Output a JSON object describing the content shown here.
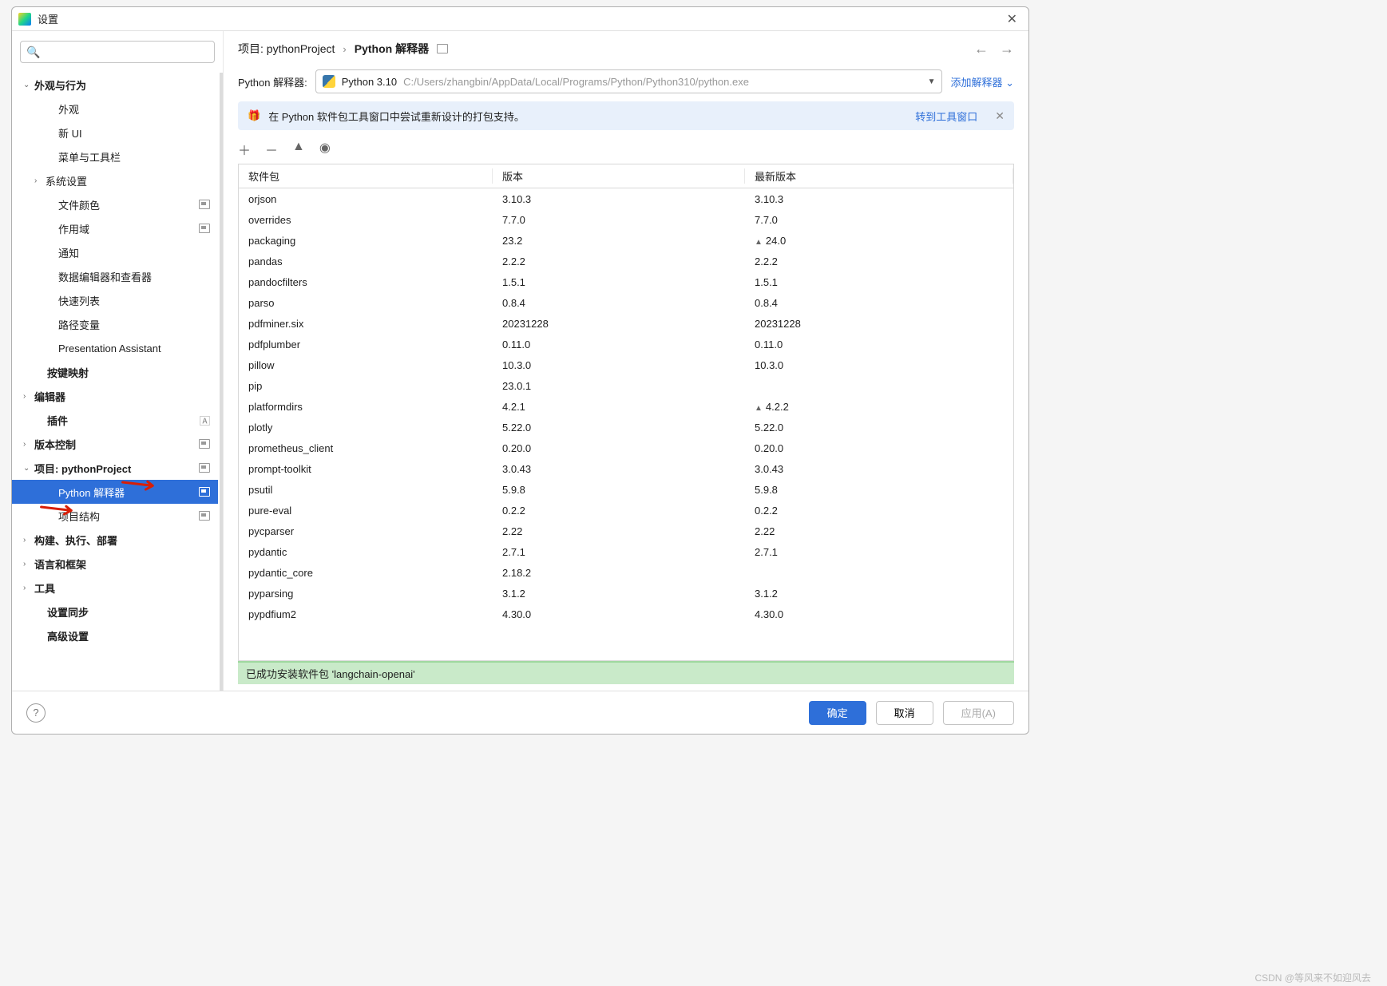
{
  "window": {
    "title": "设置"
  },
  "search": {
    "placeholder": ""
  },
  "sidebar": [
    {
      "label": "外观与行为",
      "bold": true,
      "chev": "v",
      "indent": 0
    },
    {
      "label": "外观",
      "indent": 2
    },
    {
      "label": "新 UI",
      "indent": 2
    },
    {
      "label": "菜单与工具栏",
      "indent": 2
    },
    {
      "label": "系统设置",
      "chev": ">",
      "indent": 1
    },
    {
      "label": "文件颜色",
      "indent": 2,
      "badge": true
    },
    {
      "label": "作用域",
      "indent": 2,
      "badge": true
    },
    {
      "label": "通知",
      "indent": 2
    },
    {
      "label": "数据编辑器和查看器",
      "indent": 2
    },
    {
      "label": "快速列表",
      "indent": 2
    },
    {
      "label": "路径变量",
      "indent": 2
    },
    {
      "label": "Presentation Assistant",
      "indent": 2
    },
    {
      "label": "按键映射",
      "bold": true,
      "indent": 0,
      "pad": true
    },
    {
      "label": "编辑器",
      "bold": true,
      "chev": ">",
      "indent": 0
    },
    {
      "label": "插件",
      "bold": true,
      "indent": 0,
      "pad": true,
      "lang": true
    },
    {
      "label": "版本控制",
      "bold": true,
      "chev": ">",
      "indent": 0,
      "badge": true
    },
    {
      "label": "项目: pythonProject",
      "bold": true,
      "chev": "v",
      "indent": 0,
      "badge": true
    },
    {
      "label": "Python 解释器",
      "indent": 2,
      "badge": true,
      "selected": true
    },
    {
      "label": "项目结构",
      "indent": 2,
      "badge": true
    },
    {
      "label": "构建、执行、部署",
      "bold": true,
      "chev": ">",
      "indent": 0
    },
    {
      "label": "语言和框架",
      "bold": true,
      "chev": ">",
      "indent": 0
    },
    {
      "label": "工具",
      "bold": true,
      "chev": ">",
      "indent": 0
    },
    {
      "label": "设置同步",
      "bold": true,
      "indent": 0,
      "pad": true
    },
    {
      "label": "高级设置",
      "bold": true,
      "indent": 0,
      "pad": true
    }
  ],
  "breadcrumb": {
    "project": "项目: pythonProject",
    "sep": "›",
    "page": "Python 解释器"
  },
  "interpreter": {
    "label": "Python 解释器:",
    "name": "Python 3.10",
    "path": "C:/Users/zhangbin/AppData/Local/Programs/Python/Python310/python.exe",
    "add": "添加解释器"
  },
  "banner": {
    "text": "在 Python 软件包工具窗口中尝试重新设计的打包支持。",
    "link": "转到工具窗口"
  },
  "columns": {
    "name": "软件包",
    "version": "版本",
    "latest": "最新版本"
  },
  "packages": [
    {
      "n": "orjson",
      "v": "3.10.3",
      "l": "3.10.3"
    },
    {
      "n": "overrides",
      "v": "7.7.0",
      "l": "7.7.0"
    },
    {
      "n": "packaging",
      "v": "23.2",
      "l": "24.0",
      "up": true
    },
    {
      "n": "pandas",
      "v": "2.2.2",
      "l": "2.2.2"
    },
    {
      "n": "pandocfilters",
      "v": "1.5.1",
      "l": "1.5.1"
    },
    {
      "n": "parso",
      "v": "0.8.4",
      "l": "0.8.4"
    },
    {
      "n": "pdfminer.six",
      "v": "20231228",
      "l": "20231228"
    },
    {
      "n": "pdfplumber",
      "v": "0.11.0",
      "l": "0.11.0"
    },
    {
      "n": "pillow",
      "v": "10.3.0",
      "l": "10.3.0"
    },
    {
      "n": "pip",
      "v": "23.0.1",
      "l": ""
    },
    {
      "n": "platformdirs",
      "v": "4.2.1",
      "l": "4.2.2",
      "up": true
    },
    {
      "n": "plotly",
      "v": "5.22.0",
      "l": "5.22.0"
    },
    {
      "n": "prometheus_client",
      "v": "0.20.0",
      "l": "0.20.0"
    },
    {
      "n": "prompt-toolkit",
      "v": "3.0.43",
      "l": "3.0.43"
    },
    {
      "n": "psutil",
      "v": "5.9.8",
      "l": "5.9.8"
    },
    {
      "n": "pure-eval",
      "v": "0.2.2",
      "l": "0.2.2"
    },
    {
      "n": "pycparser",
      "v": "2.22",
      "l": "2.22"
    },
    {
      "n": "pydantic",
      "v": "2.7.1",
      "l": "2.7.1"
    },
    {
      "n": "pydantic_core",
      "v": "2.18.2",
      "l": ""
    },
    {
      "n": "pyparsing",
      "v": "3.1.2",
      "l": "3.1.2"
    },
    {
      "n": "pypdfium2",
      "v": "4.30.0",
      "l": "4.30.0"
    }
  ],
  "status": "已成功安装软件包 'langchain-openai'",
  "buttons": {
    "ok": "确定",
    "cancel": "取消",
    "apply": "应用(A)"
  },
  "watermark": "CSDN @等风来不如迎风去"
}
